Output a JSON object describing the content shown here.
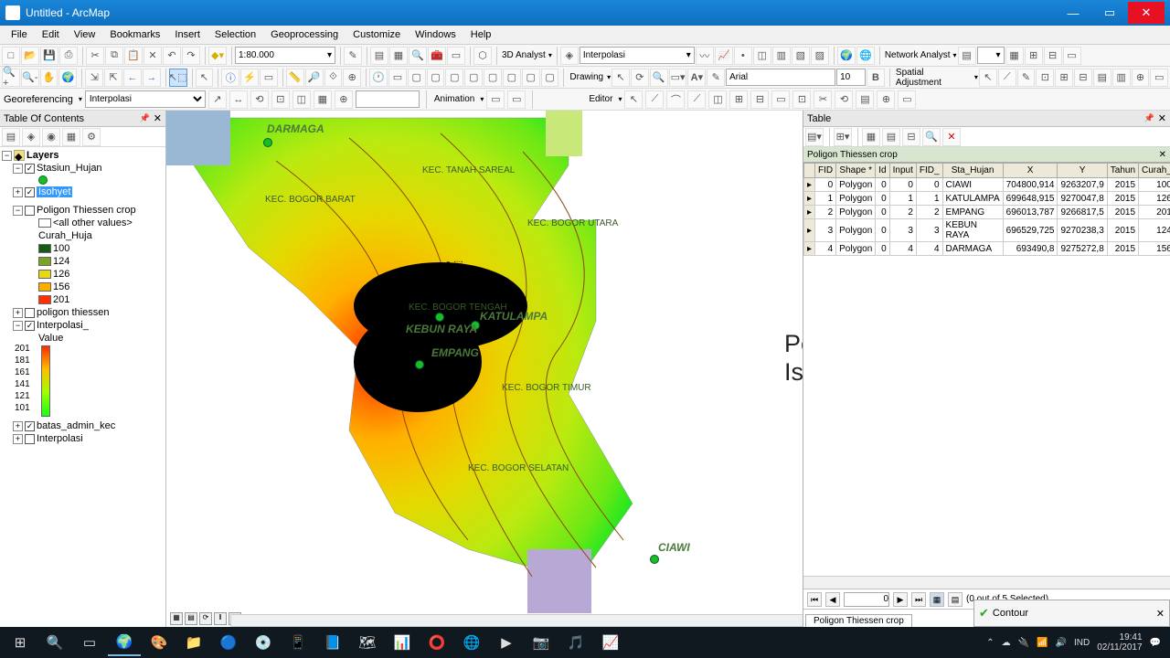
{
  "title": "Untitled - ArcMap",
  "menus": [
    "File",
    "Edit",
    "View",
    "Bookmarks",
    "Insert",
    "Selection",
    "Geoprocessing",
    "Customize",
    "Windows",
    "Help"
  ],
  "scale": "1:80.000",
  "analyst3d": "3D Analyst",
  "interpolasi_drop": "Interpolasi",
  "network_analyst": "Network Analyst",
  "drawing_label": "Drawing",
  "font_name": "Arial",
  "font_size": "10",
  "spatial_adj": "Spatial Adjustment",
  "georef_label": "Georeferencing",
  "georef_layer": "Interpolasi",
  "animation_label": "Animation",
  "editor_label": "Editor",
  "toc_title": "Table Of Contents",
  "layers_label": "Layers",
  "layer_stasiun": "Stasiun_Hujan",
  "layer_isohyet": "Isohyet",
  "layer_polthies": "Poligon Thiessen crop",
  "allother": "<all other values>",
  "curah_field": "Curah_Huja",
  "classes": [
    "100",
    "124",
    "126",
    "156",
    "201"
  ],
  "class_colors": [
    "#165b16",
    "#7aa524",
    "#e8d717",
    "#ffae00",
    "#ff2f00"
  ],
  "layer_polthies2": "poligon thiessen",
  "layer_interp": "Interpolasi_",
  "value_label": "Value",
  "ramp_labels": [
    "201",
    "181",
    "161",
    "141",
    "121",
    "101"
  ],
  "layer_batas": "batas_admin_kec",
  "layer_interp2": "Interpolasi",
  "map_labels": {
    "darmaga": "DARMAGA",
    "katulampa": "KATULAMPA",
    "kebunraya": "KEBUN RAYA",
    "empang": "EMPANG",
    "ciawi": "CIAWI",
    "tanahsareal": "KEC. TANAH SAREAL",
    "bogorbarat": "KEC. BOGOR BARAT",
    "bogorutara": "KEC. BOGOR UTARA",
    "bogortengah": "KEC. BOGOR TENGAH",
    "bogortimur": "KEC. BOGOR TIMUR",
    "bogorselatan": "KEC. BOGOR SELATAN"
  },
  "big_text": "Peta Curah Hujan menggunakan Isohyet",
  "table_title": "Table",
  "table_name": "Poligon Thiessen crop",
  "table_cols": [
    "FID",
    "Shape *",
    "Id",
    "Input",
    "FID_",
    "Sta_Hujan",
    "X",
    "Y",
    "Tahun",
    "Curah_"
  ],
  "table_rows": [
    [
      "0",
      "Polygon",
      "0",
      "0",
      "0",
      "CIAWI",
      "704800,914",
      "9263207,9",
      "2015",
      "100"
    ],
    [
      "1",
      "Polygon",
      "0",
      "1",
      "1",
      "KATULAMPA",
      "699648,915",
      "9270047,8",
      "2015",
      "126"
    ],
    [
      "2",
      "Polygon",
      "0",
      "2",
      "2",
      "EMPANG",
      "696013,787",
      "9266817,5",
      "2015",
      "201"
    ],
    [
      "3",
      "Polygon",
      "0",
      "3",
      "3",
      "KEBUN RAYA",
      "696529,725",
      "9270238,3",
      "2015",
      "124"
    ],
    [
      "4",
      "Polygon",
      "0",
      "4",
      "4",
      "DARMAGA",
      "693490,8",
      "9275272,8",
      "2015",
      "156"
    ]
  ],
  "nav_pos": "0",
  "nav_status": "(0 out of 5 Selected)",
  "notif_text": "Contour",
  "tray_lang": "IND",
  "tray_time": "19:41",
  "tray_date": "02/11/2017"
}
